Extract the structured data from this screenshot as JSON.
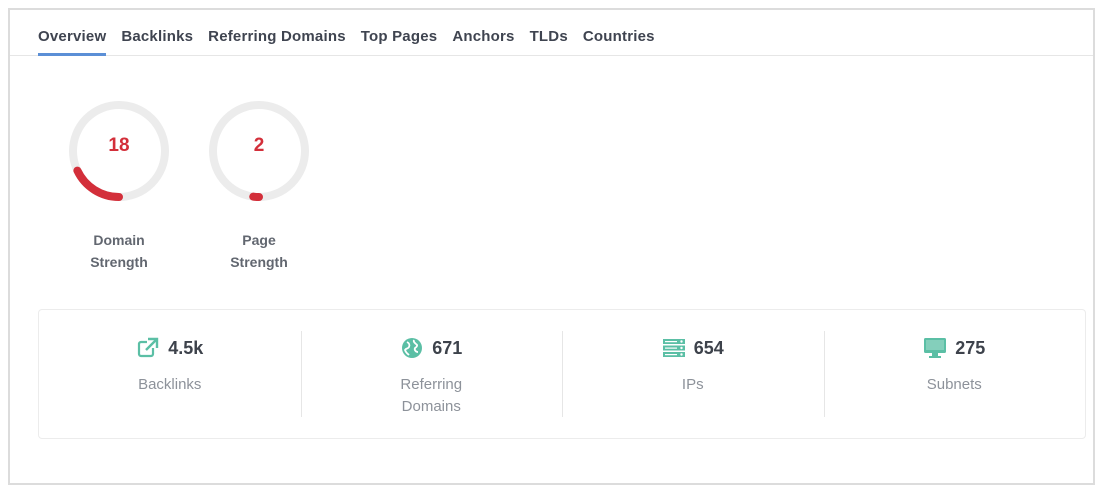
{
  "tabs": [
    {
      "label": "Overview",
      "active": true
    },
    {
      "label": "Backlinks"
    },
    {
      "label": "Referring Domains"
    },
    {
      "label": "Top Pages"
    },
    {
      "label": "Anchors"
    },
    {
      "label": "TLDs"
    },
    {
      "label": "Countries"
    }
  ],
  "gauges": {
    "domain": {
      "value": "18",
      "label_line1": "Domain",
      "label_line2": "Strength",
      "percent": 18
    },
    "page": {
      "value": "2",
      "label_line1": "Page",
      "label_line2": "Strength",
      "percent": 2
    }
  },
  "stats": {
    "backlinks": {
      "value": "4.5k",
      "label": "Backlinks",
      "icon": "external-link-icon"
    },
    "referring_domains": {
      "value": "671",
      "label_line1": "Referring",
      "label_line2": "Domains",
      "icon": "globe-icon"
    },
    "ips": {
      "value": "654",
      "label": "IPs",
      "icon": "server-icon"
    },
    "subnets": {
      "value": "275",
      "label": "Subnets",
      "icon": "monitor-icon"
    }
  },
  "colors": {
    "accent_tab": "#5b8fd6",
    "gauge_value": "#d32f3a",
    "gauge_track": "#ececec",
    "stat_icon": "#5bbfa5"
  }
}
